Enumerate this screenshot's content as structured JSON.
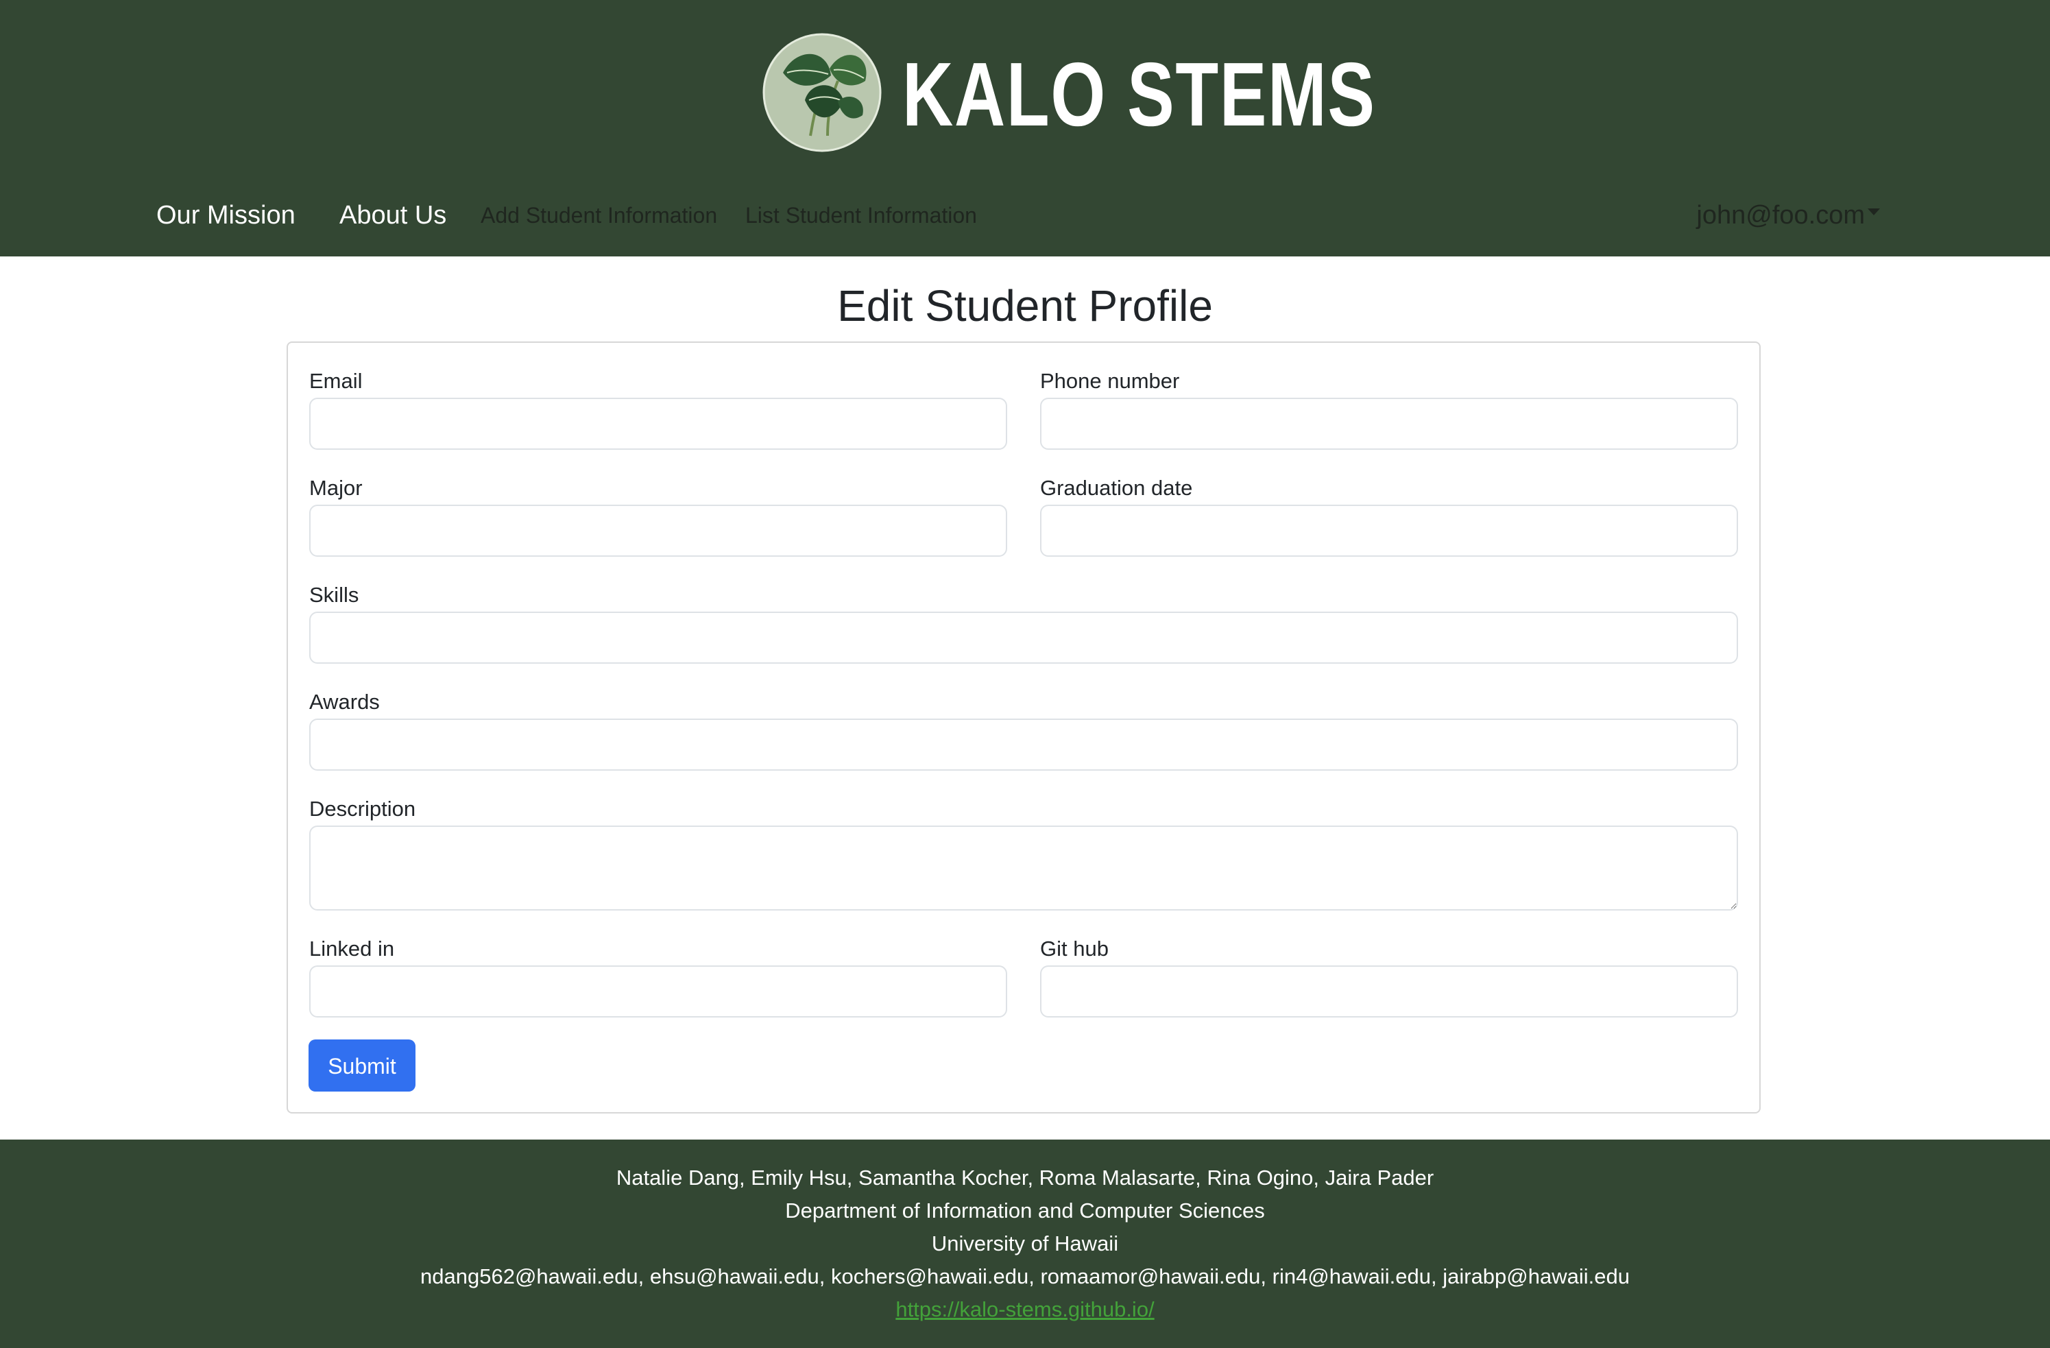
{
  "brand": {
    "title": "KALO STEMS"
  },
  "nav": {
    "mission": "Our Mission",
    "about": "About Us",
    "add_student": "Add Student Information",
    "list_student": "List Student Information",
    "user": "john@foo.com"
  },
  "colors": {
    "header_bg": "#334733",
    "primary_button": "#3170f0",
    "footer_link": "#43a23a"
  },
  "page": {
    "title": "Edit Student Profile"
  },
  "form": {
    "email": {
      "label": "Email",
      "value": ""
    },
    "phone": {
      "label": "Phone number",
      "value": ""
    },
    "major": {
      "label": "Major",
      "value": ""
    },
    "graduation": {
      "label": "Graduation date",
      "value": ""
    },
    "skills": {
      "label": "Skills",
      "value": ""
    },
    "awards": {
      "label": "Awards",
      "value": ""
    },
    "description": {
      "label": "Description",
      "value": ""
    },
    "linkedin": {
      "label": "Linked in",
      "value": ""
    },
    "github": {
      "label": "Git hub",
      "value": ""
    },
    "submit_label": "Submit"
  },
  "footer": {
    "names": "Natalie Dang, Emily Hsu, Samantha Kocher, Roma Malasarte, Rina Ogino, Jaira Pader",
    "department": "Department of Information and Computer Sciences",
    "university": "University of Hawaii",
    "emails": "ndang562@hawaii.edu, ehsu@hawaii.edu, kochers@hawaii.edu, romaamor@hawaii.edu, rin4@hawaii.edu, jairabp@hawaii.edu",
    "link": "https://kalo-stems.github.io/"
  },
  "icons": {
    "logo": "taro-leaf-logo-icon",
    "dropdown": "caret-down-icon"
  }
}
